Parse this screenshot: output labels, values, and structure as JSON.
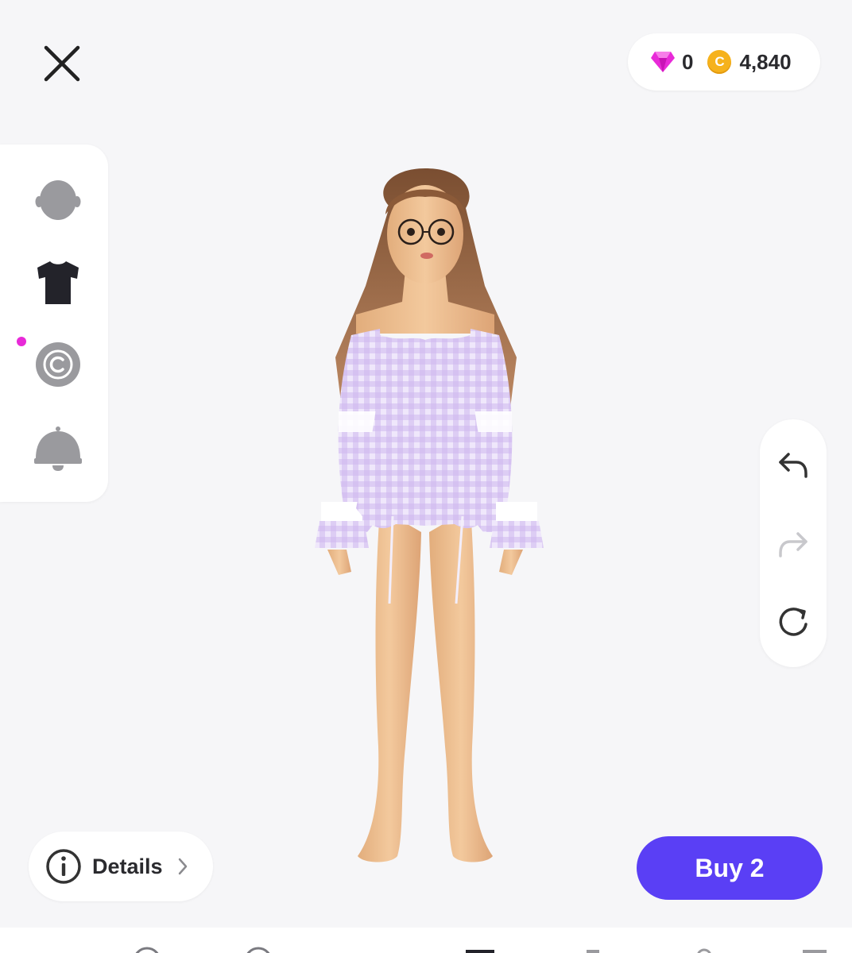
{
  "header": {
    "close_icon": "close-icon",
    "currency": {
      "gems": "0",
      "coin_symbol": "C",
      "coins": "4,840",
      "gem_color": "#e82ad8",
      "coin_color": "#f6b21c"
    }
  },
  "sidebar": {
    "items": [
      {
        "name": "face",
        "icon": "head-icon",
        "selected": false
      },
      {
        "name": "clothing",
        "icon": "tshirt-icon",
        "selected": true
      },
      {
        "name": "creator",
        "icon": "copyright-icon",
        "selected": false,
        "has_notification": true
      },
      {
        "name": "notifications",
        "icon": "bell-icon",
        "selected": false
      }
    ]
  },
  "history": {
    "undo_icon": "undo-icon",
    "redo_icon": "redo-icon",
    "reset_icon": "reset-icon"
  },
  "footer": {
    "details_label": "Details",
    "buy_label": "Buy 2",
    "accent_color": "#5a3ff5"
  }
}
